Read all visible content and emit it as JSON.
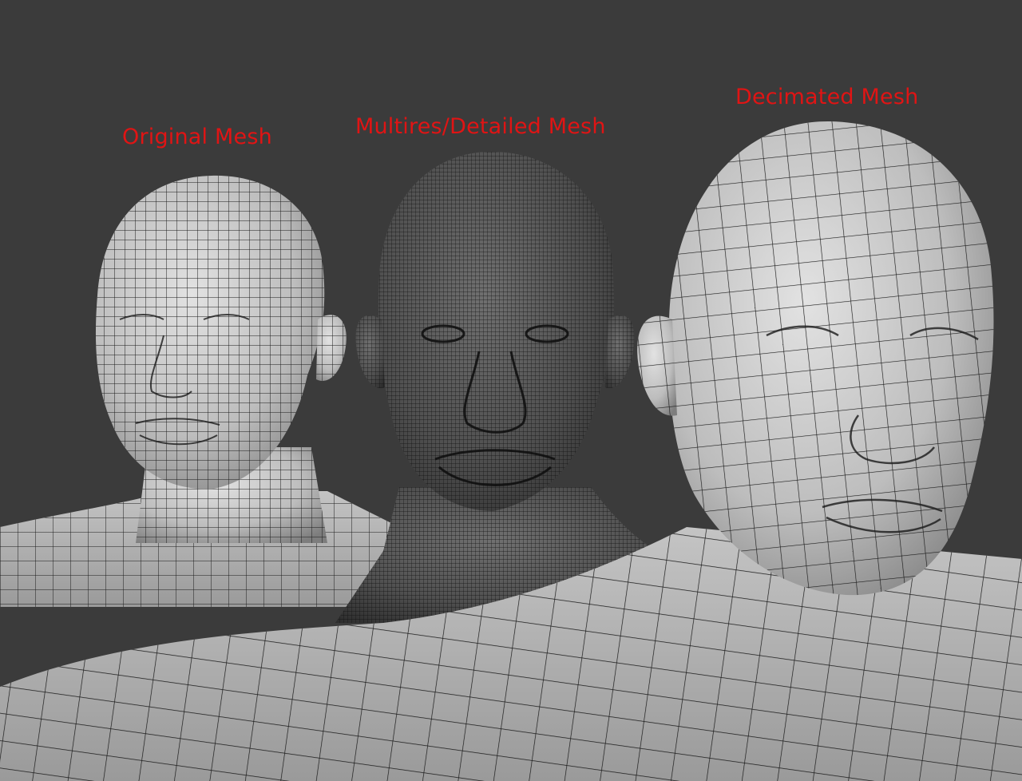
{
  "labels": {
    "original": "Original Mesh",
    "multires": "Multires/Detailed Mesh",
    "decimated": "Decimated Mesh"
  },
  "colors": {
    "background": "#3b3b3b",
    "label": "#e01414",
    "surface_light": "#c9c9c9",
    "surface_dark": "#5a5a5a",
    "wire": "#161616"
  },
  "meshes": {
    "original": {
      "density": "medium"
    },
    "multires": {
      "density": "high"
    },
    "decimated": {
      "density": "low"
    }
  }
}
